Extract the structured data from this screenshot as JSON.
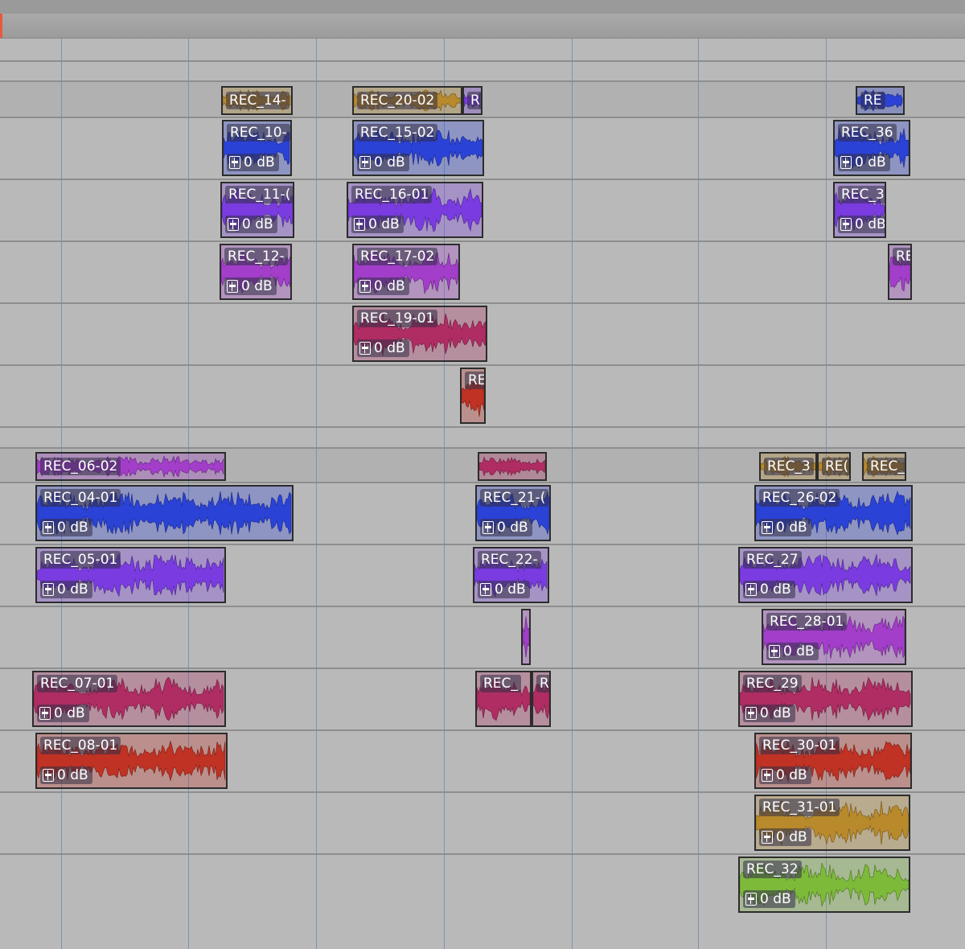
{
  "colors": {
    "blue": "#2b42d6",
    "violet": "#7a3ce0",
    "purple": "#a23ec9",
    "magenta": "#b02d63",
    "red": "#c03224",
    "gold": "#b98a2c",
    "green": "#7dba3a"
  },
  "gain_label": "0 dB",
  "clips": {
    "rec14": {
      "name": "REC_14-"
    },
    "rec20_02": {
      "name": "REC_20-02"
    },
    "rec20_r": {
      "name": "R"
    },
    "recRE_top": {
      "name": "RE"
    },
    "rec10": {
      "name": "REC_10-"
    },
    "rec15_02": {
      "name": "REC_15-02"
    },
    "rec36": {
      "name": "REC_36"
    },
    "rec11": {
      "name": "REC_11-("
    },
    "rec16_01": {
      "name": "REC_16-01"
    },
    "rec3x": {
      "name": "REC_3"
    },
    "rec12": {
      "name": "REC_12-"
    },
    "rec17_02": {
      "name": "REC_17-02"
    },
    "recRE_small": {
      "name": "RE"
    },
    "rec19_01": {
      "name": "REC_19-01"
    },
    "recRE_red": {
      "name": "RE"
    },
    "rec06_02": {
      "name": "REC_06-02"
    },
    "rec3_b": {
      "name": "REC_3"
    },
    "recREC_b": {
      "name": "RE("
    },
    "recREC_c": {
      "name": "REC_"
    },
    "rec04_01": {
      "name": "REC_04-01"
    },
    "rec21": {
      "name": "REC_21-("
    },
    "rec26_02": {
      "name": "REC_26-02"
    },
    "rec05_01": {
      "name": "REC_05-01"
    },
    "rec22": {
      "name": "REC_22-"
    },
    "rec27": {
      "name": "REC_27"
    },
    "rec28_01": {
      "name": "REC_28-01"
    },
    "rec07_01": {
      "name": "REC_07-01"
    },
    "recREC_mag": {
      "name": "REC_"
    },
    "recR_mag": {
      "name": "R"
    },
    "rec29": {
      "name": "REC_29"
    },
    "rec08_01": {
      "name": "REC_08-01"
    },
    "rec30_01": {
      "name": "REC_30-01"
    },
    "rec31_01": {
      "name": "REC_31-01"
    },
    "rec32": {
      "name": "REC_32"
    }
  }
}
